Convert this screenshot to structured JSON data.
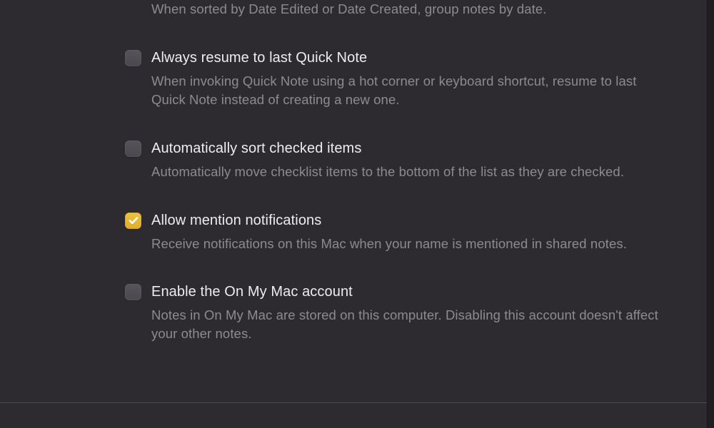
{
  "orphan_description": "When sorted by Date Edited or Date Created, group notes by date.",
  "prefs": [
    {
      "title": "Always resume to last Quick Note",
      "description": "When invoking Quick Note using a hot corner or keyboard shortcut, resume to last Quick Note instead of creating a new one.",
      "checked": false
    },
    {
      "title": "Automatically sort checked items",
      "description": "Automatically move checklist items to the bottom of the list as they are checked.",
      "checked": false
    },
    {
      "title": "Allow mention notifications",
      "description": "Receive notifications on this Mac when your name is mentioned in shared notes.",
      "checked": true
    },
    {
      "title": "Enable the On My Mac account",
      "description": "Notes in On My Mac are stored on this computer. Disabling this account doesn't affect your other notes.",
      "checked": false
    }
  ]
}
